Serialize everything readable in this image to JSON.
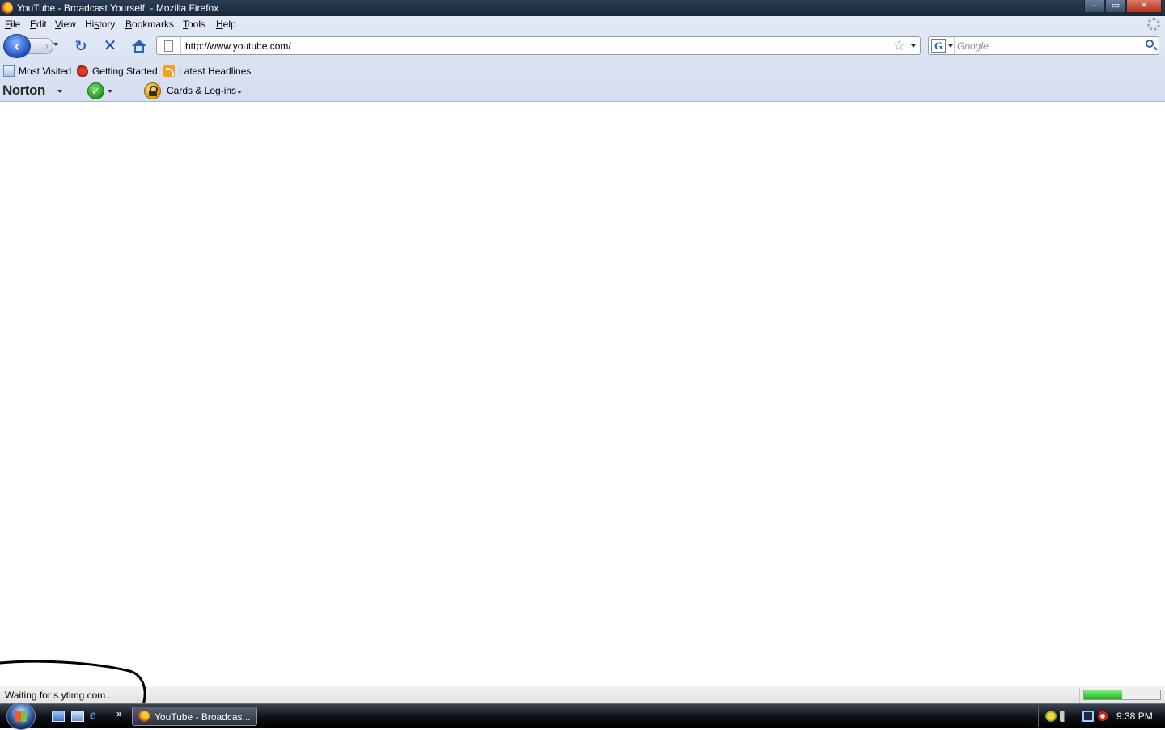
{
  "window": {
    "title": "YouTube - Broadcast Yourself. - Mozilla Firefox",
    "controls": {
      "minimize": "–",
      "maximize": "▭",
      "close": "✕"
    }
  },
  "menu": {
    "items": [
      {
        "label": "File",
        "mnemonic": "F"
      },
      {
        "label": "Edit",
        "mnemonic": "E"
      },
      {
        "label": "View",
        "mnemonic": "V"
      },
      {
        "label": "History",
        "mnemonic": "s"
      },
      {
        "label": "Bookmarks",
        "mnemonic": "B"
      },
      {
        "label": "Tools",
        "mnemonic": "T"
      },
      {
        "label": "Help",
        "mnemonic": "H"
      }
    ]
  },
  "navigation": {
    "back_glyph": "‹",
    "forward_glyph": "›",
    "reload_glyph": "↻",
    "stop_glyph": "✕",
    "url": "http://www.youtube.com/",
    "search_placeholder": "Google",
    "search_engine_glyph": "G"
  },
  "bookmarks": {
    "items": [
      {
        "label": "Most Visited",
        "icon": "most-visited-icon"
      },
      {
        "label": "Getting Started",
        "icon": "firefox-getting-started-icon"
      },
      {
        "label": "Latest Headlines",
        "icon": "rss-feed-icon"
      }
    ]
  },
  "norton": {
    "logo": "Norton",
    "check_glyph": "✓",
    "cards_label": "Cards & Log-ins"
  },
  "status": {
    "text": "Waiting for s.ytimg.com...",
    "progress": 0.5
  },
  "taskbar": {
    "quick_launch_more": "»",
    "ie_glyph": "e",
    "task_label": "YouTube - Broadcas...",
    "clock": "9:38 PM"
  },
  "colors": {
    "titlebar": "#1a2739",
    "chrome": "#d4deef",
    "progress_fill": "#1cb518",
    "taskbar": "#0d1017"
  }
}
